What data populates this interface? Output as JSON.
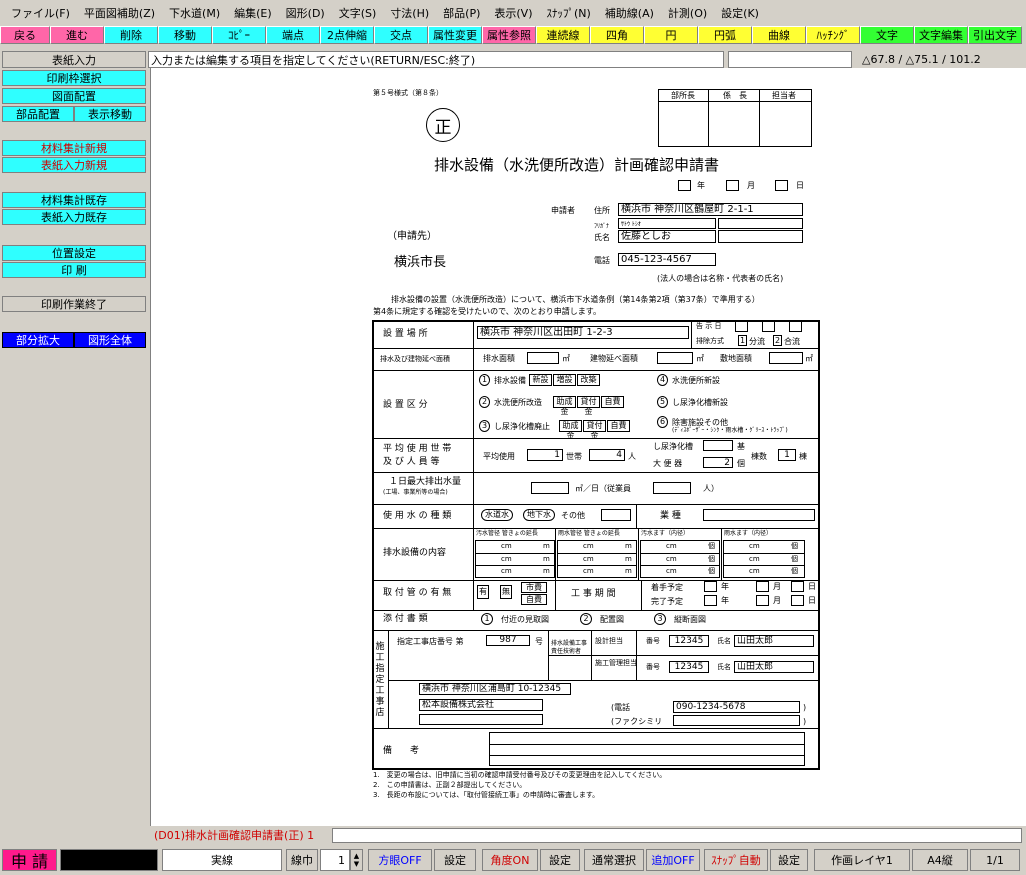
{
  "menu": [
    "ファイル(F)",
    "平面図補助(Z)",
    "下水道(M)",
    "編集(E)",
    "図形(D)",
    "文字(S)",
    "寸法(H)",
    "部品(P)",
    "表示(V)",
    "ｽﾅｯﾌﾟ(N)",
    "補助線(A)",
    "計測(O)",
    "設定(K)"
  ],
  "toolbar": [
    {
      "label": "戻る",
      "bg": "#ff66a8",
      "w": 50
    },
    {
      "label": "進む",
      "bg": "#ff66a8",
      "w": 54
    },
    {
      "label": "削除",
      "bg": "#2fffff",
      "w": 54
    },
    {
      "label": "移動",
      "bg": "#2fffff",
      "w": 54
    },
    {
      "label": "ｺﾋﾟｰ",
      "bg": "#2fffff",
      "w": 54
    },
    {
      "label": "端点",
      "bg": "#2fffff",
      "w": 54
    },
    {
      "label": "2点伸縮",
      "bg": "#2fffff",
      "w": 54
    },
    {
      "label": "交点",
      "bg": "#2fffff",
      "w": 54
    },
    {
      "label": "属性変更",
      "bg": "#2fffff",
      "w": 54
    },
    {
      "label": "属性参照",
      "bg": "#ff66a8",
      "w": 54
    },
    {
      "label": "連続線",
      "bg": "#ffff33",
      "w": 54
    },
    {
      "label": "四角",
      "bg": "#ffff33",
      "w": 54
    },
    {
      "label": "円",
      "bg": "#ffff33",
      "w": 54
    },
    {
      "label": "円弧",
      "bg": "#ffff33",
      "w": 54
    },
    {
      "label": "曲線",
      "bg": "#ffff33",
      "w": 54
    },
    {
      "label": "ﾊｯﾁﾝｸﾞ",
      "bg": "#ffff33",
      "w": 54
    },
    {
      "label": "文字",
      "bg": "#33ff33",
      "w": 54
    },
    {
      "label": "文字編集",
      "bg": "#33ff33",
      "w": 54
    },
    {
      "label": "引出文字",
      "bg": "#33ff33",
      "w": 54
    }
  ],
  "status_line": {
    "mode": "表紙入力",
    "prompt": "入力または編集する項目を指定してください(RETURN/ESC:終了)",
    "coords": "△67.8 / △75.1 / 101.2"
  },
  "sidebar": {
    "print_frame": "印刷枠選択",
    "layout": "図面配置",
    "part_layout": "部品配置",
    "display_move": "表示移動",
    "material_new": "材料集計新規",
    "cover_new": "表紙入力新規",
    "material_existing": "材料集計既存",
    "cover_existing": "表紙入力既存",
    "position": "位置設定",
    "print": "印 刷",
    "print_end": "印刷作業終了",
    "zoom_part": "部分拡大",
    "zoom_all": "図形全体"
  },
  "form": {
    "form_no": "第５号様式（第８条）",
    "sei": "正",
    "stamp_headers": [
      "部所長",
      "係　長",
      "担当者"
    ],
    "title": "排水設備（水洗便所改造）計画確認申請書",
    "date_labels": [
      "年",
      "月",
      "日"
    ],
    "applicant_label": "申請者",
    "address_label": "住所",
    "address_value": "横浜市 神奈川区鶴屋町 2-1-1",
    "furigana_label": "ﾌﾘｶﾞﾅ",
    "furigana_value": "ｻﾄｳ ﾄｼｵ",
    "name_label": "氏名",
    "name_value": "佐藤としお",
    "phone_label": "電話",
    "phone_value": "045-123-4567",
    "corp_note": "(法人の場合は名称・代表者の氏名)",
    "recipient_label": "（申請先）",
    "recipient": "横浜市長",
    "preamble1": "排水設備の設置（水洗便所改造）について、横浜市下水道条例（第14条第2項（第37条）で準用する）",
    "preamble2": "第4条に規定する確認を受けたいので、次のとおり申請します。",
    "site_label": "設 置 場 所",
    "site_value": "横浜市 神奈川区出田町 1-2-3",
    "notify_no": "告 示 日",
    "sewer_method": "排除方式",
    "sewer_opt1": "分流",
    "sewer_opt2": "合流",
    "sewer_opt1_no": "1",
    "sewer_opt2_no": "2",
    "area_label": "排水及び建物延べ面積",
    "area_drain": "排水面積",
    "area_floor": "建物延べ面積",
    "area_site": "敷地面積",
    "area_unit": "㎡",
    "division_label": "設 置 区 分",
    "div_items": [
      {
        "no": "1",
        "label": "排水設備",
        "tags": [
          "新設",
          "増設",
          "改築"
        ]
      },
      {
        "no": "2",
        "label": "水洗便所改造",
        "tags": [
          "助成金",
          "貸付金",
          "自費"
        ]
      },
      {
        "no": "3",
        "label": "し尿浄化槽廃止",
        "tags": [
          "助成金",
          "貸付金",
          "自費"
        ]
      }
    ],
    "div_items_right": [
      {
        "no": "4",
        "label": "水洗便所新設"
      },
      {
        "no": "5",
        "label": "し尿浄化槽新設"
      },
      {
        "no": "6",
        "label": "除害施設その他"
      }
    ],
    "div_note": "(ﾃﾞｨｽﾎﾟｰｻﾞｰ・ｼﾝｸ・雨水槽・ｸﾞﾘｰｽ・ﾄﾗｯﾌﾟ)",
    "avg_label1": "平 均 使 用 世 帯",
    "avg_label2": "及 び 人 員 等",
    "avg_use": "平均使用",
    "avg_households_value": "1",
    "avg_households": "世帯",
    "avg_persons_value": "4",
    "avg_persons": "人",
    "septic_label": "し尿浄化槽",
    "septic_unit": "基",
    "toilet_label": "大 便 器",
    "toilet_value": "2",
    "toilet_unit": "個",
    "building_count": "棟数",
    "building_count_value": "1",
    "building_unit": "棟",
    "max_label1": "１日最大排出水量",
    "max_label2": "(工場、事業所等の場合)",
    "max_unit": "㎥／日（従業員",
    "max_unit2": "人）",
    "water_label": "使 用 水 の 種 類",
    "water_opts": [
      "水道水",
      "地下水",
      "その他"
    ],
    "business_label": "業 種",
    "content_label": "排水設備の内容",
    "content_cols": [
      "汚水管径 管きょの延長",
      "雨水管径 管きょの延長",
      "汚水ます（内径）",
      "雨水ます（内径）"
    ],
    "unit_cm": "cm",
    "unit_m": "m",
    "unit_pcs": "個",
    "attach_label": "取 付 管 の 有 無",
    "attach_opts": [
      "有",
      "無"
    ],
    "attach_tags": [
      "市費",
      "自費"
    ],
    "period_label": "工 事 期 間",
    "start_label": "着手予定",
    "end_label": "完了予定",
    "docs_label": "添 付 書 類",
    "docs": [
      {
        "no": "1",
        "label": "付近の見取図"
      },
      {
        "no": "2",
        "label": "配置図"
      },
      {
        "no": "3",
        "label": "縦断面図"
      }
    ],
    "contractor_vlabel": "施工指定工事店",
    "designated_no_label": "指定工事店番号 第",
    "designated_no_value": "987",
    "designated_no_suffix": "号",
    "engineer_label": "排水設備工事責任技術者",
    "design_label": "設計担当",
    "construct_label": "施工管理担当",
    "number_label": "番号",
    "engineer_no": "12345",
    "engineer_no2": "12345",
    "engineer_name_label": "氏名",
    "engineer_name": "山田太郎",
    "engineer_name2": "山田太郎",
    "contractor_address": "横浜市 神奈川区浦島町 10-12345",
    "contractor_name": "松本設備株式会社",
    "contractor_phone_label": "(電話",
    "contractor_phone": "090-1234-5678",
    "contractor_fax_label": "(ファクシミリ",
    "remarks_label": "備　　考",
    "notes": [
      "1.　変更の場合は、旧申請に当初の確認申請受付番号及びその変更理由を記入してください。",
      "2.　この申請書は、正副２部提出してください。",
      "3.　長距の布設については、「取付管接続工事」の申請時に審査します。"
    ]
  },
  "bottom_title": "(D01)排水計画確認申請書(正) 1",
  "statusbar": {
    "mode": "申 請",
    "line_type": "実線",
    "line_width_label": "線巾",
    "line_width_value": "1",
    "grid": "方眼OFF",
    "grid_settings": "設定",
    "angle": "角度ON",
    "angle_settings": "設定",
    "select_mode": "通常選択",
    "add": "追加OFF",
    "snap": "ｽﾅｯﾌﾟ自動",
    "snap_settings": "設定",
    "layer": "作画レイヤ1",
    "paper": "A4縦",
    "page": "1/1"
  },
  "colors": {
    "cyan": "#2fffff",
    "pink": "#ff66a8",
    "yellow": "#ffff33",
    "green": "#33ff33",
    "red": "#d00000",
    "blue": "#0000ff"
  }
}
